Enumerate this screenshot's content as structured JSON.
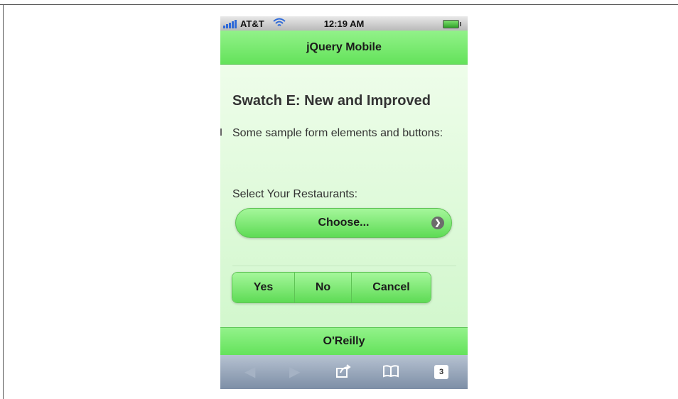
{
  "status_bar": {
    "carrier": "AT&T",
    "time": "12:19 AM"
  },
  "header": {
    "title": "jQuery Mobile"
  },
  "content": {
    "page_title": "Swatch E: New and Improved",
    "description": "Some sample form elements and buttons:",
    "select_label": "Select Your Restaurants:",
    "select_value": "Choose...",
    "buttons": [
      "Yes",
      "No",
      "Cancel"
    ]
  },
  "footer": {
    "title": "O'Reilly"
  },
  "toolbar": {
    "tabs_count": "3",
    "icons": [
      "back-icon",
      "forward-icon",
      "share-icon",
      "bookmarks-icon",
      "tabs-icon"
    ]
  },
  "colors": {
    "bar_green": "#7aea70",
    "button_green": "#5edb55",
    "toolbar_blue": "#7d8ea6"
  }
}
